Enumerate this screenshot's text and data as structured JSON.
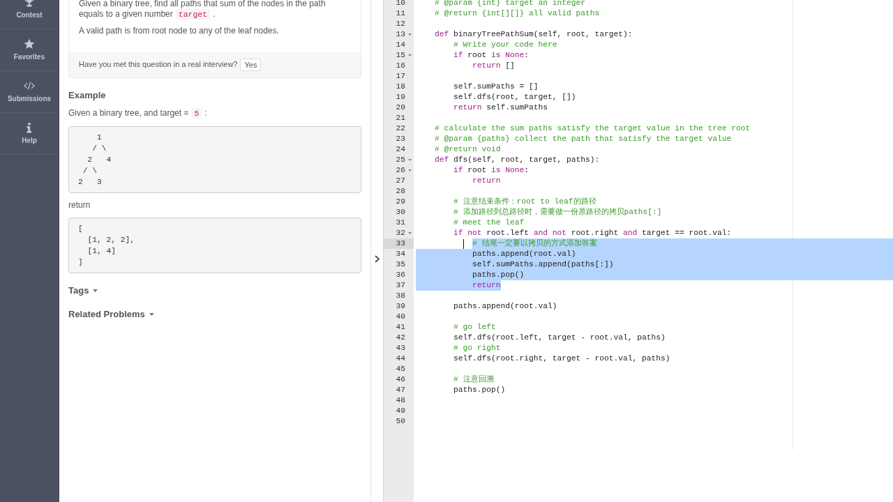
{
  "nav": [
    {
      "label": "Contest"
    },
    {
      "label": "Favorites"
    },
    {
      "label": "Submissions"
    },
    {
      "label": "Help"
    }
  ],
  "problem": {
    "description": [
      {
        "parts": [
          {
            "kind": "text",
            "text": "Given a binary tree, find all paths that sum of the nodes in the path equals to a given number"
          },
          {
            "kind": "code",
            "text": "target"
          },
          {
            "kind": "text",
            "text": "."
          }
        ]
      },
      {
        "parts": [
          {
            "kind": "text",
            "text": "A valid path is from root node to any of the leaf nodes."
          }
        ]
      }
    ],
    "interview_question": "Have you met this question in a real interview?",
    "interview_button": "Yes"
  },
  "example": {
    "heading": "Example",
    "intro": [
      {
        "kind": "text",
        "text": "Given a binary tree, and target ="
      },
      {
        "kind": "code",
        "text": "5"
      },
      {
        "kind": "text",
        "text": ":"
      }
    ],
    "tree": "    1\n   / \\\n  2   4\n / \\\n2   3",
    "return_label": "return",
    "output": "[\n  [1, 2, 2],\n  [1, 4]\n]"
  },
  "tags": {
    "label": "Tags"
  },
  "related_problems": {
    "label": "Related Problems"
  },
  "editor": {
    "lines": [
      {
        "number": "10",
        "foldable": false,
        "selected": false,
        "cursor": false,
        "tokens": [
          {
            "kind": "comment",
            "text": "    # @param {int} target an integer"
          }
        ]
      },
      {
        "number": "11",
        "foldable": false,
        "selected": false,
        "cursor": false,
        "tokens": [
          {
            "kind": "comment",
            "text": "    # @return {int[][]} all valid paths"
          }
        ]
      },
      {
        "number": "12",
        "foldable": false,
        "selected": false,
        "cursor": false
      },
      {
        "number": "13",
        "foldable": true,
        "selected": false,
        "cursor": false,
        "tokens": [
          {
            "kind": "keyword",
            "text": "    def"
          },
          {
            "kind": "plain",
            "text": " binaryTreePathSum(self, root, target):"
          }
        ]
      },
      {
        "number": "14",
        "foldable": false,
        "selected": false,
        "cursor": false,
        "tokens": [
          {
            "kind": "comment",
            "text": "        # Write your code here"
          }
        ]
      },
      {
        "number": "15",
        "foldable": true,
        "selected": false,
        "cursor": false,
        "tokens": [
          {
            "kind": "keyword",
            "text": "        if"
          },
          {
            "kind": "plain",
            "text": " root "
          },
          {
            "kind": "keyword",
            "text": "is None"
          },
          {
            "kind": "plain",
            "text": ":"
          }
        ]
      },
      {
        "number": "16",
        "foldable": false,
        "selected": false,
        "cursor": false,
        "tokens": [
          {
            "kind": "keyword",
            "text": "            return"
          },
          {
            "kind": "plain",
            "text": " []"
          }
        ]
      },
      {
        "number": "17",
        "foldable": false,
        "selected": false,
        "cursor": false
      },
      {
        "number": "18",
        "foldable": false,
        "selected": false,
        "cursor": false,
        "tokens": [
          {
            "kind": "plain",
            "text": "        self.sumPaths = []"
          }
        ]
      },
      {
        "number": "19",
        "foldable": false,
        "selected": false,
        "cursor": false,
        "tokens": [
          {
            "kind": "plain",
            "text": "        self.dfs(root, target, [])"
          }
        ]
      },
      {
        "number": "20",
        "foldable": false,
        "selected": false,
        "cursor": false,
        "tokens": [
          {
            "kind": "keyword",
            "text": "        return"
          },
          {
            "kind": "plain",
            "text": " self.sumPaths"
          }
        ]
      },
      {
        "number": "21",
        "foldable": false,
        "selected": false,
        "cursor": false
      },
      {
        "number": "22",
        "foldable": false,
        "selected": false,
        "cursor": false,
        "tokens": [
          {
            "kind": "comment",
            "text": "    # calculate the sum paths satisfy the target value in the tree root"
          }
        ]
      },
      {
        "number": "23",
        "foldable": false,
        "selected": false,
        "cursor": false,
        "tokens": [
          {
            "kind": "comment",
            "text": "    # @param {paths} collect the path that satisfy the target value"
          }
        ]
      },
      {
        "number": "24",
        "foldable": false,
        "selected": false,
        "cursor": false,
        "tokens": [
          {
            "kind": "comment",
            "text": "    # @return void"
          }
        ]
      },
      {
        "number": "25",
        "foldable": true,
        "selected": false,
        "cursor": false,
        "tokens": [
          {
            "kind": "keyword",
            "text": "    def"
          },
          {
            "kind": "plain",
            "text": " dfs(self, root, target, paths):"
          }
        ]
      },
      {
        "number": "26",
        "foldable": true,
        "selected": false,
        "cursor": false,
        "tokens": [
          {
            "kind": "keyword",
            "text": "        if"
          },
          {
            "kind": "plain",
            "text": " root "
          },
          {
            "kind": "keyword",
            "text": "is None"
          },
          {
            "kind": "plain",
            "text": ":"
          }
        ]
      },
      {
        "number": "27",
        "foldable": false,
        "selected": false,
        "cursor": false,
        "tokens": [
          {
            "kind": "keyword",
            "text": "            return"
          }
        ]
      },
      {
        "number": "28",
        "foldable": false,
        "selected": false,
        "cursor": false
      },
      {
        "number": "29",
        "foldable": false,
        "selected": false,
        "cursor": false,
        "tokens": [
          {
            "kind": "comment",
            "text": "        # 注意结束条件：root to leaf的路径"
          }
        ]
      },
      {
        "number": "30",
        "foldable": false,
        "selected": false,
        "cursor": false,
        "tokens": [
          {
            "kind": "comment",
            "text": "        # 添加路径到总路径时，需要做一份原路径的拷贝paths[:]"
          }
        ]
      },
      {
        "number": "31",
        "foldable": false,
        "selected": false,
        "cursor": false,
        "tokens": [
          {
            "kind": "comment",
            "text": "        # meet the leaf"
          }
        ]
      },
      {
        "number": "32",
        "foldable": true,
        "selected": false,
        "cursor": false,
        "tokens": [
          {
            "kind": "keyword",
            "text": "        if not"
          },
          {
            "kind": "plain",
            "text": " root.left "
          },
          {
            "kind": "keyword",
            "text": "and not"
          },
          {
            "kind": "plain",
            "text": " root.right "
          },
          {
            "kind": "keyword",
            "text": "and"
          },
          {
            "kind": "plain",
            "text": " target == root.val:"
          }
        ]
      },
      {
        "number": "33",
        "foldable": false,
        "selected": true,
        "cursor": true,
        "tokens": [
          {
            "kind": "comment",
            "text": "            # 结尾一定要以拷贝的方式添加答案"
          }
        ]
      },
      {
        "number": "34",
        "foldable": false,
        "selected": true,
        "cursor": false,
        "tokens": [
          {
            "kind": "plain",
            "text": "            paths.append(root.val)"
          }
        ]
      },
      {
        "number": "35",
        "foldable": false,
        "selected": true,
        "cursor": false,
        "tokens": [
          {
            "kind": "plain",
            "text": "            self.sumPaths.append(paths[:])"
          }
        ]
      },
      {
        "number": "36",
        "foldable": false,
        "selected": true,
        "cursor": false,
        "tokens": [
          {
            "kind": "plain",
            "text": "            paths.pop()"
          }
        ]
      },
      {
        "number": "37",
        "foldable": false,
        "selected": true,
        "cursor": false,
        "tokens": [
          {
            "kind": "keyword",
            "text": "            return"
          }
        ]
      },
      {
        "number": "38",
        "foldable": false,
        "selected": false,
        "cursor": false
      },
      {
        "number": "39",
        "foldable": false,
        "selected": false,
        "cursor": false,
        "tokens": [
          {
            "kind": "plain",
            "text": "        paths.append(root.val)"
          }
        ]
      },
      {
        "number": "40",
        "foldable": false,
        "selected": false,
        "cursor": false
      },
      {
        "number": "41",
        "foldable": false,
        "selected": false,
        "cursor": false,
        "tokens": [
          {
            "kind": "comment",
            "text": "        # go left"
          }
        ]
      },
      {
        "number": "42",
        "foldable": false,
        "selected": false,
        "cursor": false,
        "tokens": [
          {
            "kind": "plain",
            "text": "        self.dfs(root.left, target - root.val, paths)"
          }
        ]
      },
      {
        "number": "43",
        "foldable": false,
        "selected": false,
        "cursor": false,
        "tokens": [
          {
            "kind": "comment",
            "text": "        # go right"
          }
        ]
      },
      {
        "number": "44",
        "foldable": false,
        "selected": false,
        "cursor": false,
        "tokens": [
          {
            "kind": "plain",
            "text": "        self.dfs(root.right, target - root.val, paths)"
          }
        ]
      },
      {
        "number": "45",
        "foldable": false,
        "selected": false,
        "cursor": false
      },
      {
        "number": "46",
        "foldable": false,
        "selected": false,
        "cursor": false,
        "tokens": [
          {
            "kind": "comment",
            "text": "        # 注意回溯"
          }
        ]
      },
      {
        "number": "47",
        "foldable": false,
        "selected": false,
        "cursor": false,
        "tokens": [
          {
            "kind": "plain",
            "text": "        paths.pop()"
          }
        ]
      },
      {
        "number": "48",
        "foldable": false,
        "selected": false,
        "cursor": false
      },
      {
        "number": "49",
        "foldable": false,
        "selected": false,
        "cursor": false
      },
      {
        "number": "50",
        "foldable": false,
        "selected": false,
        "cursor": false
      }
    ]
  }
}
